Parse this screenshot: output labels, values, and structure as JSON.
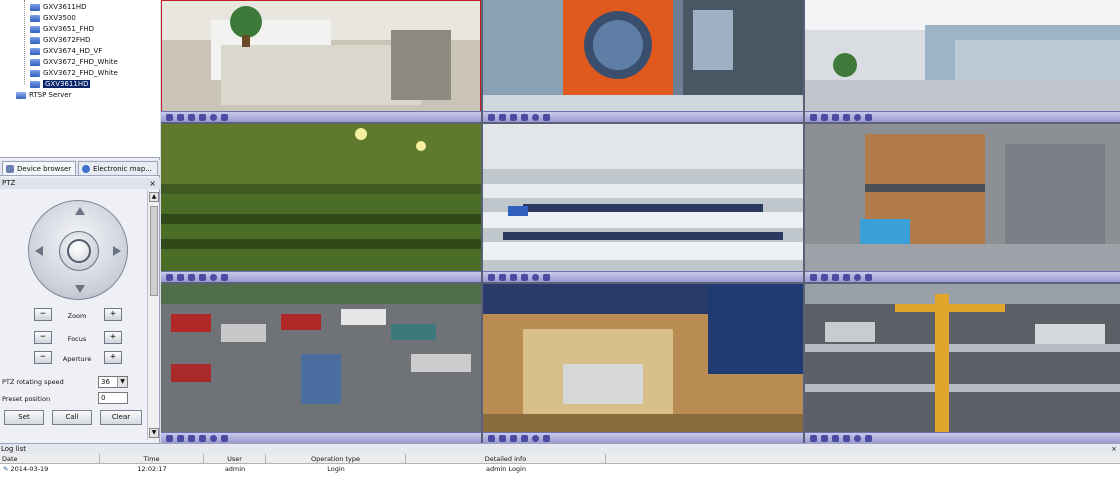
{
  "device_tree": {
    "items": [
      {
        "label": "GXV3611HD",
        "selected": false
      },
      {
        "label": "GXV3500",
        "selected": false
      },
      {
        "label": "GXV3651_FHD",
        "selected": false
      },
      {
        "label": "GXV3672FHD",
        "selected": false
      },
      {
        "label": "GXV3674_HD_VF",
        "selected": false
      },
      {
        "label": "GXV3672_FHD_White",
        "selected": false
      },
      {
        "label": "GXV3672_FHD_White",
        "selected": false
      },
      {
        "label": "GXV3611HD",
        "selected": true
      }
    ],
    "server": "RTSP Server"
  },
  "tabs": [
    {
      "label": "Device browser",
      "icon": "device-icon"
    },
    {
      "label": "Electronic map...",
      "icon": "map-icon"
    }
  ],
  "ptz": {
    "title": "PTZ",
    "zoom": "Zoom",
    "focus": "Focus",
    "aperture": "Aperture",
    "minus": "−",
    "plus": "+",
    "rotating_speed_label": "PTZ rotating speed",
    "rotating_speed_value": "36",
    "preset_label": "Preset position",
    "preset_value": "0",
    "set": "Set",
    "call": "Call",
    "clear": "Clear"
  },
  "log": {
    "title": "Log list",
    "columns": [
      "Date",
      "Time",
      "User",
      "Operation type",
      "Detailed info"
    ],
    "rows": [
      {
        "date": "2014-03-19",
        "time": "12:02:17",
        "user": "admin",
        "operation": "Login",
        "info": "admin Login"
      }
    ]
  },
  "scenes": {
    "colors": {
      "bar": "#9a9ad2",
      "active_outline": "#c02020"
    }
  }
}
